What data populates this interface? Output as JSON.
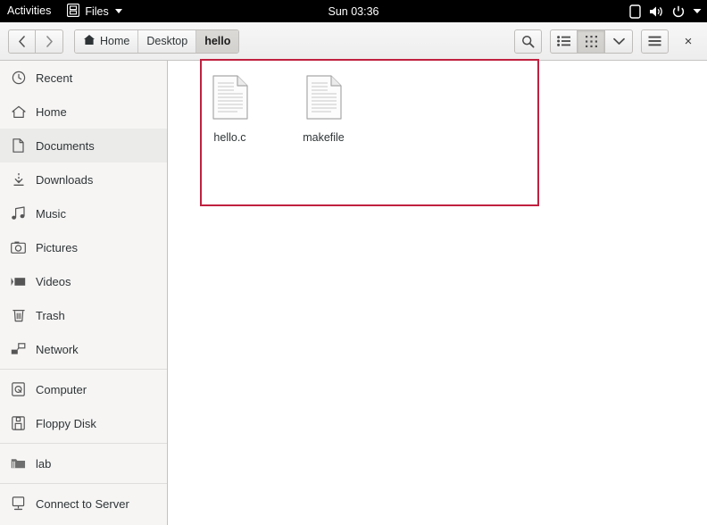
{
  "topbar": {
    "activities": "Activities",
    "app_name": "Files",
    "app_icon": "files-app-icon",
    "clock": "Sun 03:36",
    "indicators": [
      {
        "name": "screen-indicator-icon",
        "glyph": "screen"
      },
      {
        "name": "volume-icon",
        "glyph": "speaker"
      },
      {
        "name": "power-icon",
        "glyph": "power"
      },
      {
        "name": "chevron-down-icon",
        "glyph": "caret"
      }
    ]
  },
  "headerbar": {
    "back_label": "‹",
    "forward_label": "›",
    "breadcrumbs": [
      {
        "label": "Home",
        "icon": "home-icon",
        "active": false
      },
      {
        "label": "Desktop",
        "icon": "",
        "active": false
      },
      {
        "label": "hello",
        "icon": "",
        "active": true
      }
    ],
    "buttons": {
      "search": "search-icon",
      "list_view": "list-view-icon",
      "grid_view": "grid-view-icon",
      "view_options": "chevron-down-icon",
      "menu": "hamburger-menu-icon",
      "close": "×"
    },
    "active_view": "grid"
  },
  "sidebar": {
    "groups": [
      {
        "items": [
          {
            "label": "Recent",
            "icon": "clock-icon",
            "selected": false
          },
          {
            "label": "Home",
            "icon": "home-icon",
            "selected": false
          },
          {
            "label": "Documents",
            "icon": "document-icon",
            "selected": true
          },
          {
            "label": "Downloads",
            "icon": "download-icon",
            "selected": false
          },
          {
            "label": "Music",
            "icon": "music-note-icon",
            "selected": false
          },
          {
            "label": "Pictures",
            "icon": "camera-icon",
            "selected": false
          },
          {
            "label": "Videos",
            "icon": "video-icon",
            "selected": false
          },
          {
            "label": "Trash",
            "icon": "trash-icon",
            "selected": false
          },
          {
            "label": "Network",
            "icon": "network-icon",
            "selected": false
          }
        ]
      },
      {
        "items": [
          {
            "label": "Computer",
            "icon": "computer-disk-icon",
            "selected": false
          },
          {
            "label": "Floppy Disk",
            "icon": "floppy-disk-icon",
            "selected": false
          }
        ]
      },
      {
        "items": [
          {
            "label": "lab",
            "icon": "folder-icon",
            "selected": false
          }
        ]
      },
      {
        "items": [
          {
            "label": "Connect to Server",
            "icon": "connect-server-icon",
            "selected": false
          }
        ]
      }
    ]
  },
  "content": {
    "files": [
      {
        "name": "hello.c",
        "icon": "text-document-icon"
      },
      {
        "name": "makefile",
        "icon": "text-document-icon"
      }
    ],
    "annotation": {
      "name": "selection-highlight-rect",
      "color": "#c0203f"
    }
  },
  "colors": {
    "topbar_bg": "#000000",
    "header_bg": "#ededed",
    "sidebar_bg": "#f6f5f4",
    "content_bg": "#ffffff",
    "selected_row": "#ebebea",
    "annotation": "#c0203f"
  }
}
